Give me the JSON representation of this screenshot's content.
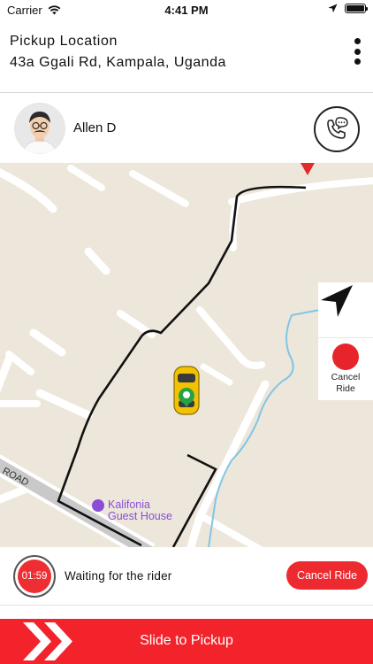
{
  "status_bar": {
    "carrier": "Carrier",
    "time": "4:41 PM"
  },
  "header": {
    "title": "Pickup Location",
    "address": "43a Ggali Rd, Kampala, Uganda"
  },
  "rider": {
    "name": "Allen D"
  },
  "map": {
    "poi": {
      "name": "Kalifonia\nGuest House"
    },
    "road_label": "ROAD",
    "cancel_label": "Cancel\nRide"
  },
  "trip_status": {
    "timer": "01:59",
    "message": "Waiting for the rider",
    "cancel_button": "Cancel Ride"
  },
  "slide": {
    "label": "Slide to Pickup"
  },
  "colors": {
    "accent": "#f2232b",
    "route": "#111111",
    "map_bg": "#ede6da",
    "water": "#7fc6e6",
    "poi": "#8a4ed6"
  },
  "icons": [
    "wifi-icon",
    "location-arrow-icon",
    "battery-icon",
    "more-vertical-icon",
    "phone-chat-icon",
    "navigate-icon",
    "close-icon",
    "double-chevron-icon",
    "car-icon",
    "destination-pin-icon",
    "poi-icon"
  ]
}
